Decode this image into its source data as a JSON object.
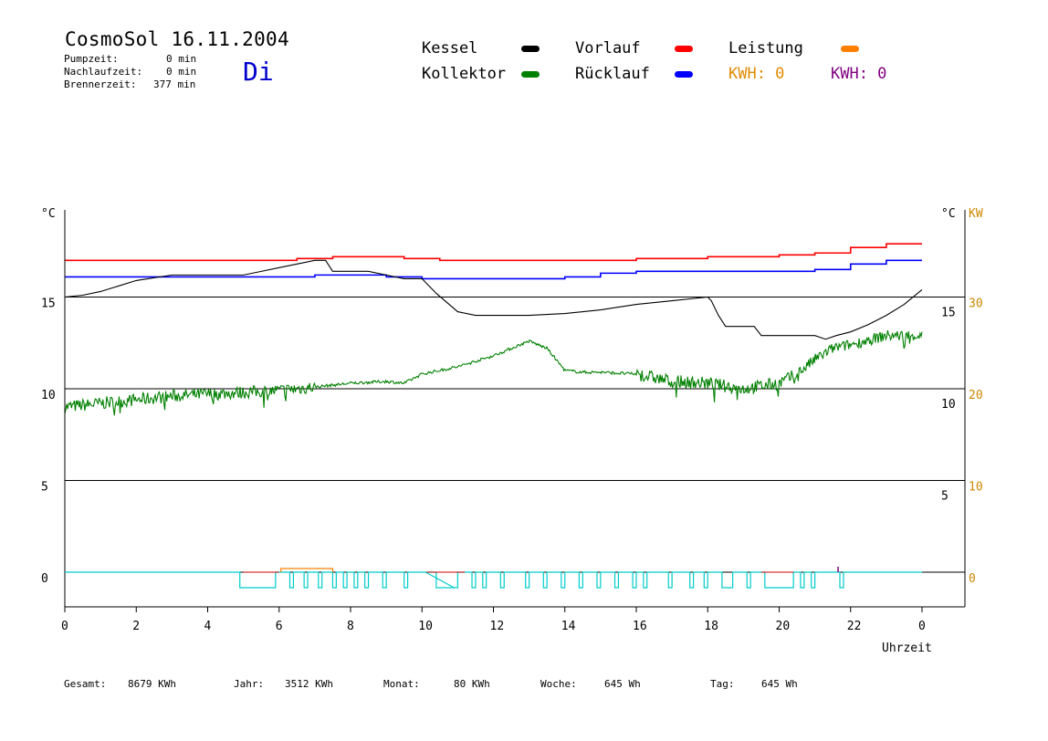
{
  "header": {
    "title": "CosmoSol 16.11.2004",
    "stats": [
      {
        "label": "Pumpzeit:",
        "value": "0 min"
      },
      {
        "label": "Nachlaufzeit:",
        "value": "0 min"
      },
      {
        "label": "Brennerzeit:",
        "value": "377 min"
      }
    ],
    "day": "Di"
  },
  "legend": {
    "kessel": {
      "label": "Kessel",
      "color": "#000000"
    },
    "kollektor": {
      "label": "Kollektor",
      "color": "#008000"
    },
    "vorlauf": {
      "label": "Vorlauf",
      "color": "#ff0000"
    },
    "ruecklauf": {
      "label": "Rücklauf",
      "color": "#0000ff"
    },
    "leistung": {
      "label": "Leistung",
      "color": "#ff8000"
    },
    "kwh1": "KWH: 0",
    "kwh2": "KWH: 0"
  },
  "footer": [
    {
      "label": "Gesamt:",
      "value": "8679 KWh"
    },
    {
      "label": "Jahr:",
      "value": "3512 KWh"
    },
    {
      "label": "Monat:",
      "value": "80 KWh"
    },
    {
      "label": "Woche:",
      "value": "645 Wh"
    },
    {
      "label": "Tag:",
      "value": "645 Wh"
    }
  ],
  "chart_data": {
    "type": "line",
    "xlabel": "Uhrzeit",
    "xlim": [
      0,
      24
    ],
    "x_ticks": [
      "0",
      "2",
      "4",
      "6",
      "8",
      "10",
      "12",
      "14",
      "16",
      "18",
      "20",
      "22",
      "0"
    ],
    "y_left": {
      "unit": "°C",
      "ticks": [
        "15",
        "10",
        "5",
        "0"
      ],
      "ylim": [
        -1.5,
        20
      ]
    },
    "y_right_1": {
      "unit": "°C",
      "ticks": [
        "15",
        "10",
        "5"
      ]
    },
    "y_right_2": {
      "unit": "KW",
      "ticks": [
        "30",
        "20",
        "10",
        "0"
      ],
      "color": "#cc8800"
    },
    "grid": true,
    "series": [
      {
        "name": "Vorlauf",
        "color": "#ff0000",
        "x": [
          0,
          6,
          6.5,
          7.5,
          8.5,
          9.5,
          10.5,
          12,
          14,
          16,
          18,
          19,
          20,
          21,
          22,
          23,
          24
        ],
        "y": [
          17.0,
          17.0,
          17.1,
          17.2,
          17.2,
          17.1,
          17.0,
          17.0,
          17.0,
          17.1,
          17.2,
          17.2,
          17.3,
          17.4,
          17.7,
          17.9,
          17.9
        ]
      },
      {
        "name": "Rücklauf",
        "color": "#0000ff",
        "x": [
          0,
          6,
          7,
          8,
          9,
          10,
          12,
          14,
          15,
          16,
          18,
          19,
          20,
          21,
          22,
          23,
          24
        ],
        "y": [
          16.1,
          16.1,
          16.2,
          16.2,
          16.1,
          16.0,
          16.0,
          16.1,
          16.3,
          16.4,
          16.4,
          16.4,
          16.4,
          16.5,
          16.8,
          17.0,
          17.0
        ]
      },
      {
        "name": "Kessel",
        "color": "#000000",
        "x": [
          0,
          0.5,
          1,
          1.5,
          2,
          3,
          4,
          5,
          5.5,
          6,
          6.5,
          7,
          7.3,
          7.5,
          8,
          8.5,
          9,
          9.5,
          10,
          10.4,
          11,
          11.5,
          12,
          13,
          14,
          15,
          16,
          17,
          18,
          18.1,
          18.3,
          18.5,
          19,
          19.3,
          19.5,
          20,
          21,
          21.3,
          21.6,
          22,
          22.5,
          23,
          23.5,
          24
        ],
        "y": [
          15.0,
          15.1,
          15.3,
          15.6,
          15.9,
          16.2,
          16.2,
          16.2,
          16.4,
          16.6,
          16.8,
          17.0,
          17.0,
          16.4,
          16.4,
          16.4,
          16.2,
          16.0,
          16.0,
          15.2,
          14.2,
          14.0,
          14.0,
          14.0,
          14.1,
          14.3,
          14.6,
          14.8,
          15.0,
          14.8,
          14.0,
          13.4,
          13.4,
          13.4,
          12.9,
          12.9,
          12.9,
          12.7,
          12.9,
          13.1,
          13.5,
          14.0,
          14.6,
          15.4
        ]
      },
      {
        "name": "Kollektor",
        "color": "#008000",
        "x": [
          0,
          1,
          2,
          3,
          4,
          5,
          6,
          7,
          8,
          9,
          9.5,
          10,
          11,
          11.5,
          12,
          12.5,
          13,
          13.5,
          14,
          14.5,
          15,
          16,
          17,
          18,
          19,
          20,
          20.5,
          21,
          21.5,
          22,
          23,
          24
        ],
        "y": [
          9.0,
          9.2,
          9.4,
          9.6,
          9.7,
          9.8,
          9.9,
          10.1,
          10.3,
          10.4,
          10.3,
          10.8,
          11.2,
          11.5,
          11.8,
          12.2,
          12.6,
          12.2,
          11.0,
          10.9,
          10.9,
          10.8,
          10.4,
          10.3,
          10.0,
          10.3,
          10.8,
          11.6,
          12.2,
          12.4,
          12.9,
          12.9
        ]
      }
    ]
  }
}
